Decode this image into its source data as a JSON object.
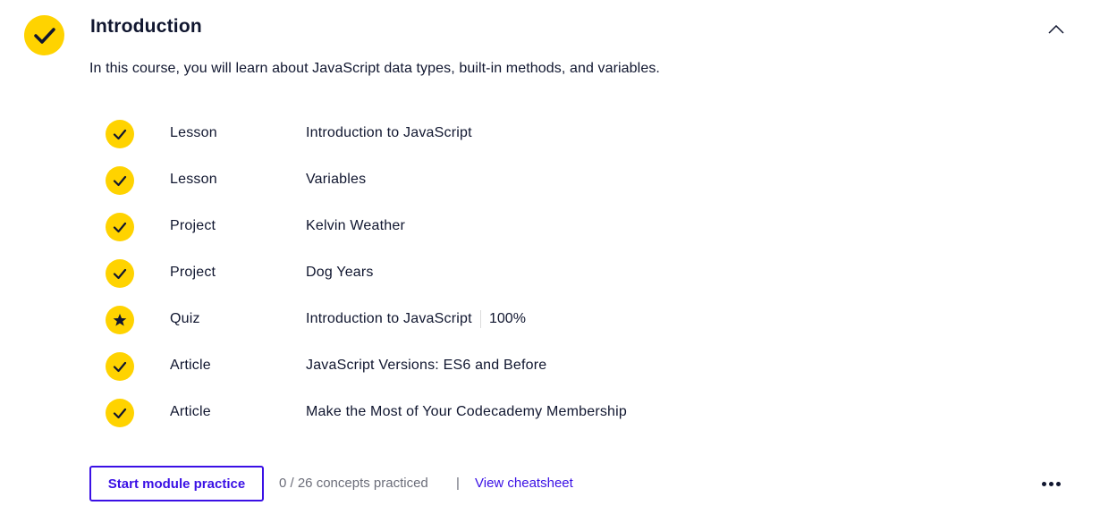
{
  "module": {
    "title": "Introduction",
    "description": "In this course, you will learn about JavaScript data types, built-in methods, and variables.",
    "status_icon": "check-icon",
    "collapse_icon": "chevron-up-icon"
  },
  "items": [
    {
      "type": "Lesson",
      "name": "Introduction to JavaScript",
      "status": "completed",
      "icon": "check-icon"
    },
    {
      "type": "Lesson",
      "name": "Variables",
      "status": "completed",
      "icon": "check-icon"
    },
    {
      "type": "Project",
      "name": "Kelvin Weather",
      "status": "completed",
      "icon": "check-icon"
    },
    {
      "type": "Project",
      "name": "Dog Years",
      "status": "completed",
      "icon": "check-icon"
    },
    {
      "type": "Quiz",
      "name": "Introduction to JavaScript",
      "status": "completed",
      "icon": "star-icon",
      "score": "100%"
    },
    {
      "type": "Article",
      "name": "JavaScript Versions: ES6 and Before",
      "status": "completed",
      "icon": "check-icon"
    },
    {
      "type": "Article",
      "name": "Make the Most of Your Codecademy Membership",
      "status": "completed",
      "icon": "check-icon"
    }
  ],
  "footer": {
    "practice_button": "Start module practice",
    "concepts": "0 / 26 concepts practiced",
    "separator": "|",
    "cheatsheet_link": "View cheatsheet",
    "more_icon": "more-horizontal-icon"
  },
  "colors": {
    "accent_yellow": "#ffd300",
    "link_blue": "#3a10e5",
    "text_dark": "#10162f",
    "text_muted": "#6b6d79"
  }
}
